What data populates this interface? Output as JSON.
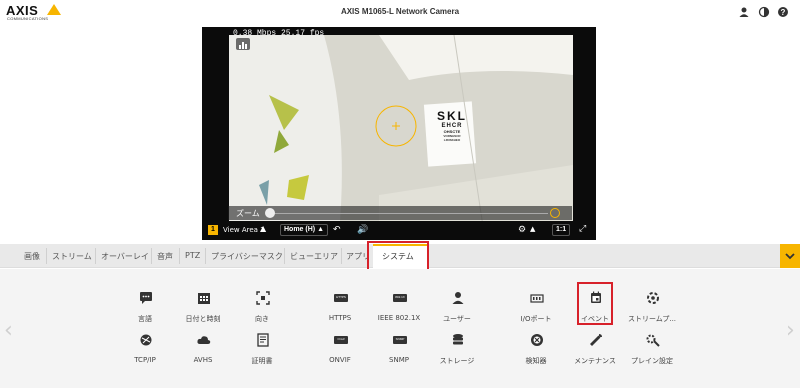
{
  "header": {
    "logo_text": "AXIS",
    "logo_sub": "COMMUNICATIONS",
    "title": "AXIS M1065-L Network Camera",
    "icons": [
      "user-icon",
      "contrast-icon",
      "help-icon"
    ]
  },
  "video": {
    "stats": "0.38 Mbps 25.17 fps",
    "chart_label": "SKL",
    "chart_rows": [
      "EHCR",
      "OHSCTE",
      "VORNHSCR",
      "LZNSKHEO"
    ],
    "zoom_label": "ズーム",
    "view_area_number": "1",
    "view_area_label": "View Area 1",
    "home_label": "Home (H)",
    "ratio_label": "1:1"
  },
  "tabs": {
    "items": [
      "画像",
      "ストリーム",
      "オーバーレイ",
      "音声",
      "PTZ",
      "プライバシーマスク",
      "ビューエリア",
      "アプリ"
    ],
    "active": "システム"
  },
  "system": {
    "row1": [
      {
        "label": "言語",
        "icon": "speech-icon"
      },
      {
        "label": "日付と時刻",
        "icon": "calendar-grid-icon"
      },
      {
        "label": "向き",
        "icon": "orientation-icon"
      },
      {
        "label": "HTTPS",
        "icon": "https-icon",
        "badge": "HTTPS"
      },
      {
        "label": "IEEE 802.1X",
        "icon": "ieee-icon",
        "badge": "802.1X"
      },
      {
        "label": "ユーザー",
        "icon": "user-icon"
      },
      {
        "label": "I/Oポート",
        "icon": "io-port-icon"
      },
      {
        "label": "イベント",
        "icon": "event-calendar-icon"
      },
      {
        "label": "ストリームプ...",
        "icon": "stream-profile-icon"
      }
    ],
    "row2": [
      {
        "label": "TCP/IP",
        "icon": "network-icon"
      },
      {
        "label": "AVHS",
        "icon": "cloud-icon"
      },
      {
        "label": "証明書",
        "icon": "certificate-icon"
      },
      {
        "label": "ONVIF",
        "icon": "onvif-icon",
        "badge": "Onvif"
      },
      {
        "label": "SNMP",
        "icon": "snmp-icon",
        "badge": "SNMP"
      },
      {
        "label": "ストレージ",
        "icon": "storage-icon"
      },
      {
        "label": "検知器",
        "icon": "detector-icon"
      },
      {
        "label": "メンテナンス",
        "icon": "wrench-icon"
      },
      {
        "label": "プレイン設定",
        "icon": "plain-config-icon"
      }
    ]
  },
  "colors": {
    "accent": "#f7b500",
    "highlight": "#d7212a"
  }
}
